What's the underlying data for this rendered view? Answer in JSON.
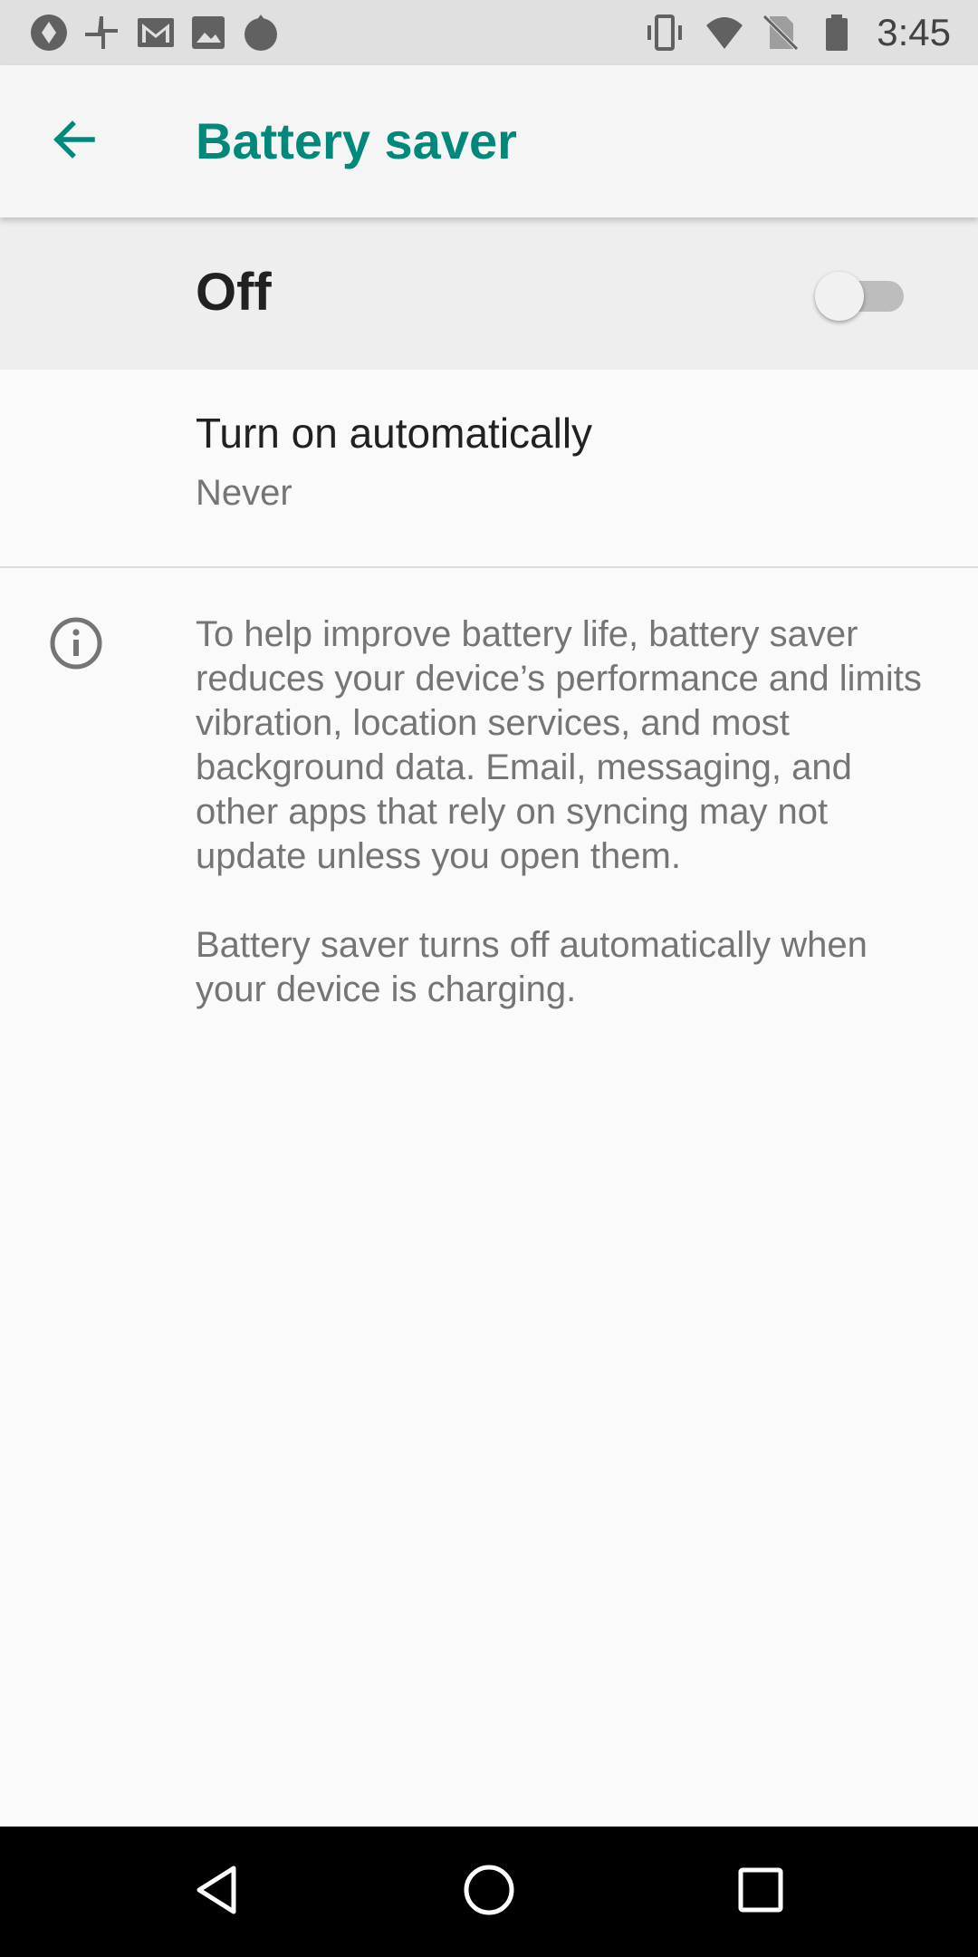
{
  "status_bar": {
    "time": "3:45",
    "left_icons": [
      "notification-app-icon",
      "pinwheel-icon",
      "gmail-icon",
      "image-icon",
      "flame-icon"
    ],
    "right_icons": [
      "vibrate-icon",
      "wifi-icon",
      "no-sim-icon",
      "battery-icon"
    ]
  },
  "app_bar": {
    "title": "Battery saver",
    "back_icon": "arrow-back-icon",
    "accent_color": "#00897b"
  },
  "master_switch": {
    "label": "Off",
    "state": "off"
  },
  "preference": {
    "title": "Turn on automatically",
    "summary": "Never"
  },
  "info": {
    "icon": "info-icon",
    "paragraph_1": "To help improve battery life, battery saver reduces your device’s performance and limits vibration, location services, and most background data. Email, messaging, and other apps that rely on syncing may not update unless you open them.",
    "paragraph_2": "Battery saver turns off automatically when your device is charging."
  },
  "nav_bar": {
    "buttons": [
      "back-triangle-icon",
      "home-circle-icon",
      "recents-square-icon"
    ]
  }
}
